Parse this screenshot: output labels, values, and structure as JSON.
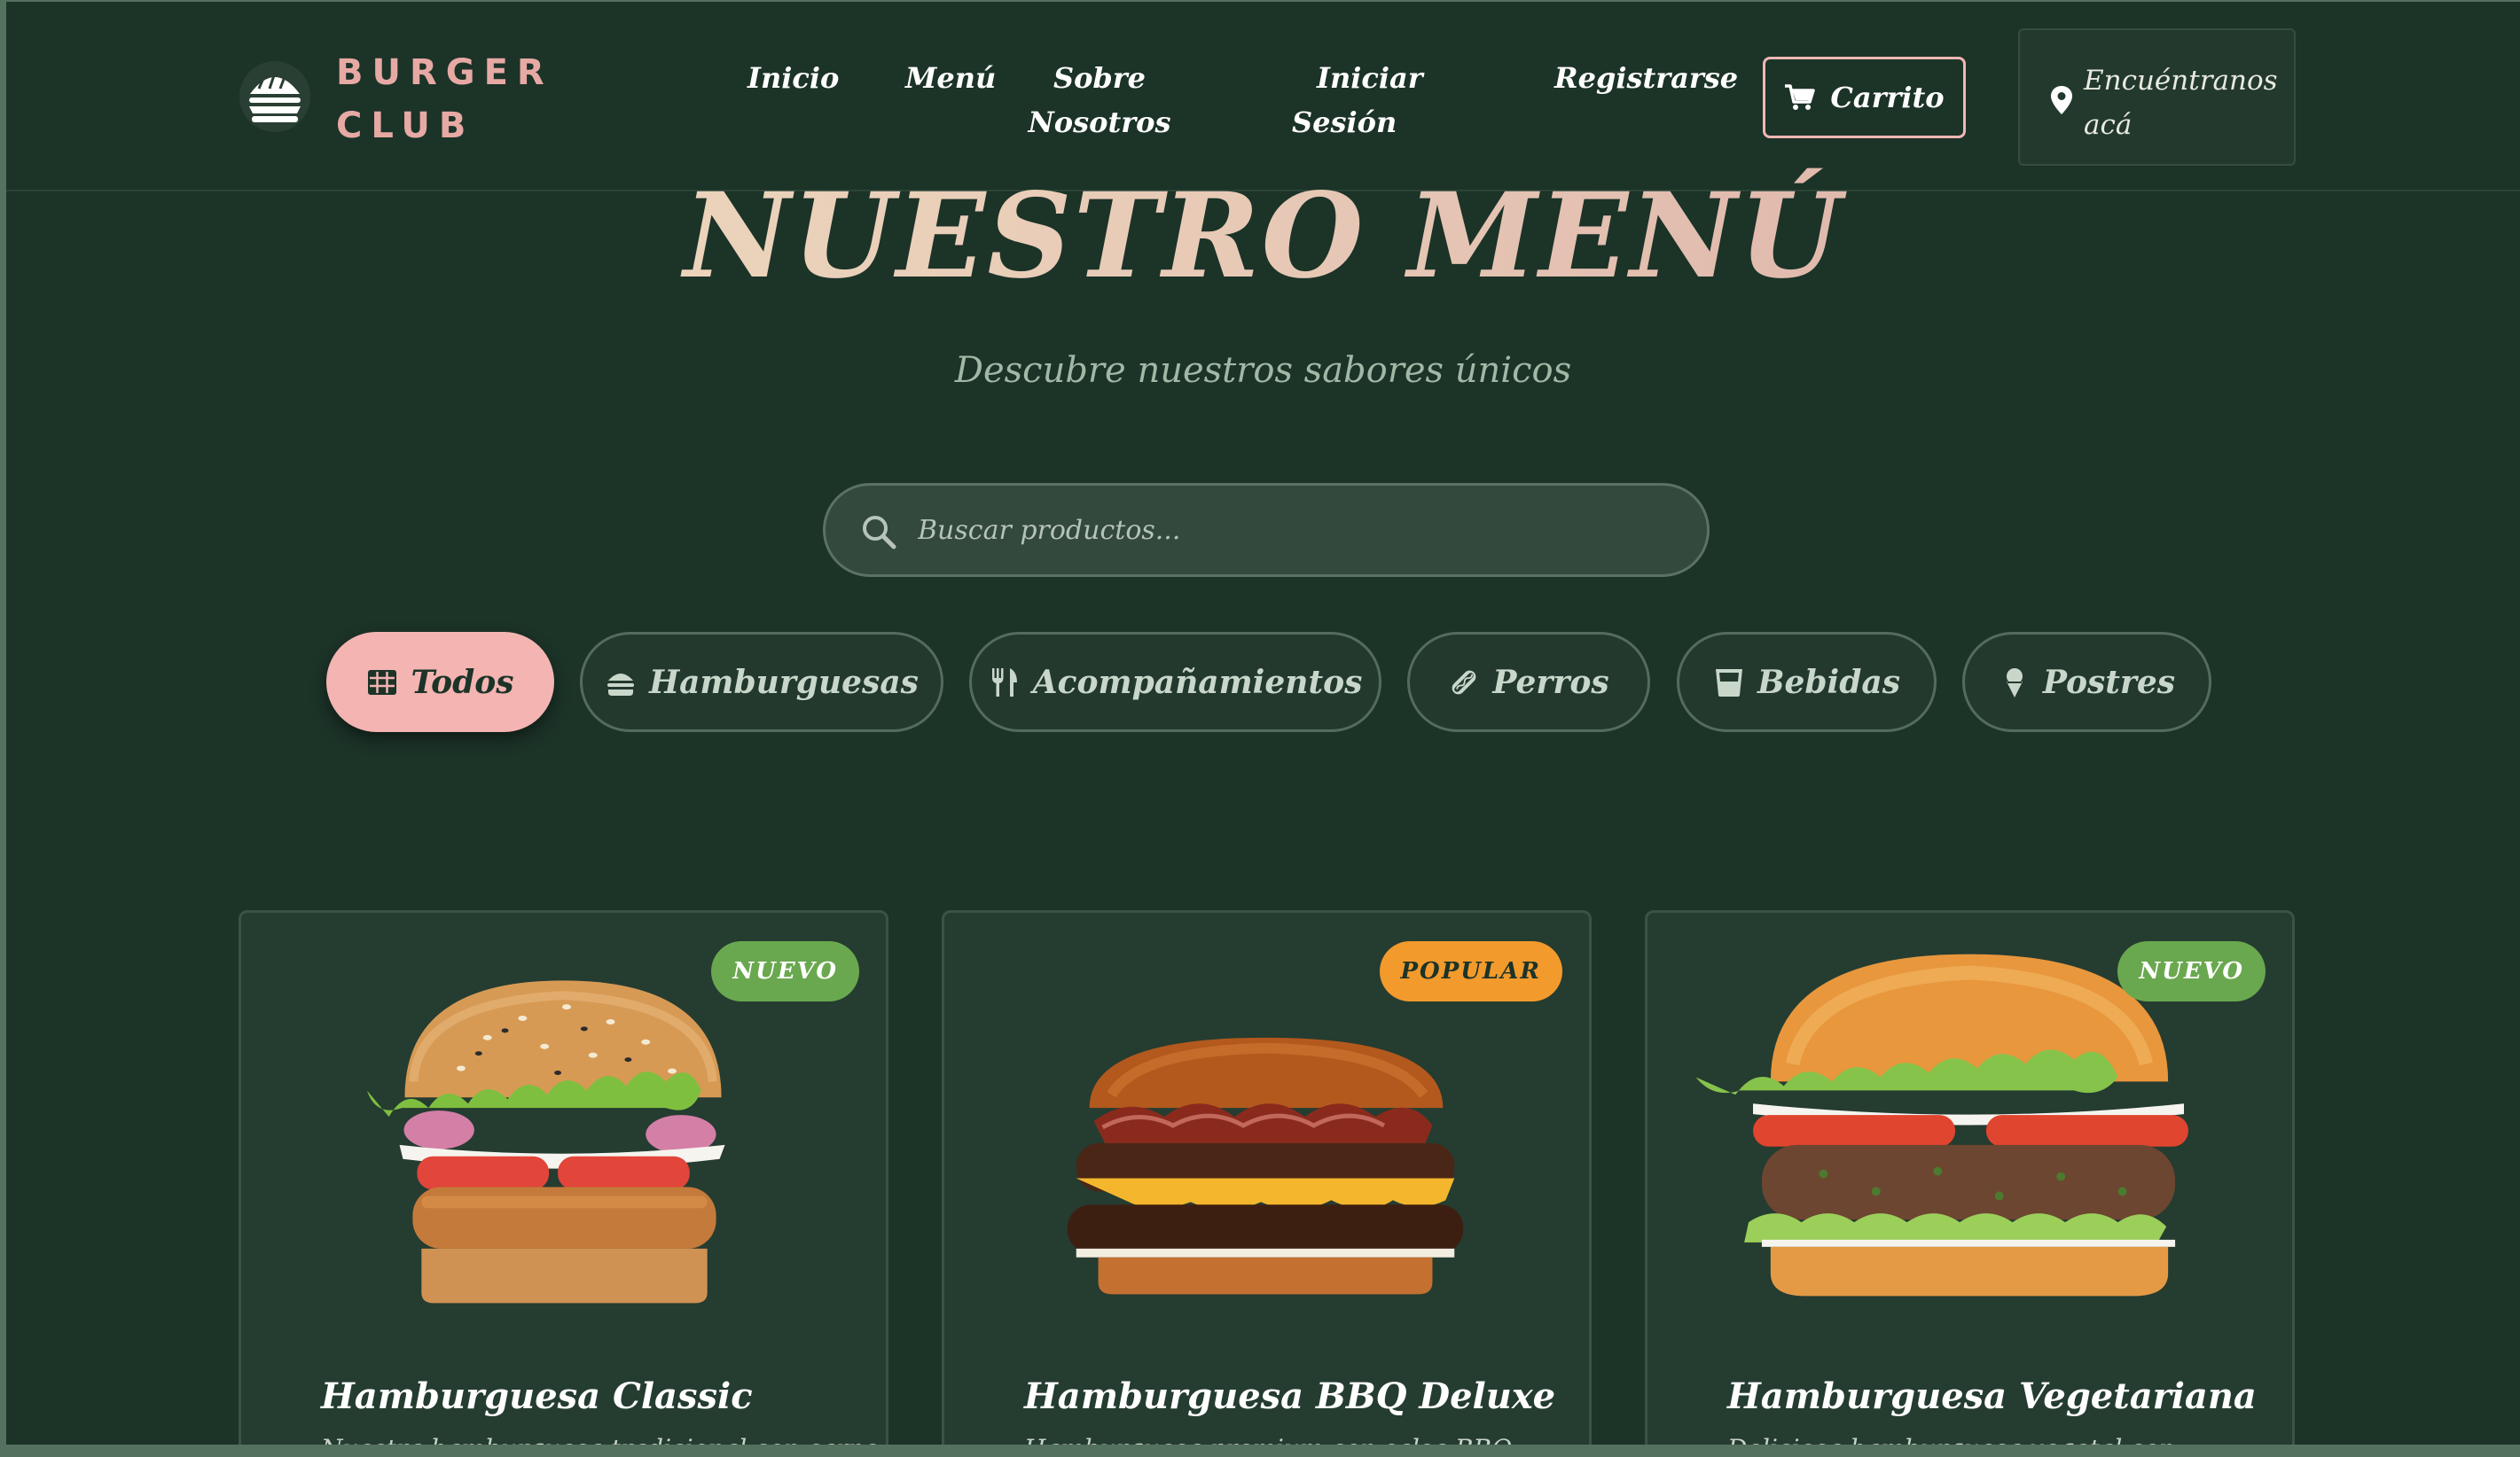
{
  "brand": {
    "line1": "BURGER",
    "line2": "CLUB"
  },
  "nav": {
    "inicio": "Inicio",
    "menu": "Menú",
    "sobre_1": "Sobre",
    "sobre_2": "Nosotros",
    "iniciar_1": "Iniciar",
    "iniciar_2": "Sesión",
    "registrarse": "Registrarse",
    "carrito": "Carrito",
    "encuentranos_1": "Encuéntranos",
    "encuentranos_2": "acá"
  },
  "hero": {
    "title": "NUESTRO MENÚ",
    "subtitle": "Descubre nuestros sabores únicos"
  },
  "search": {
    "placeholder": "Buscar productos..."
  },
  "categories": [
    {
      "label": "Todos",
      "icon": "grid-icon",
      "active": true
    },
    {
      "label": "Hamburguesas",
      "icon": "burger-icon",
      "active": false
    },
    {
      "label": "Acompañamientos",
      "icon": "utensils-icon",
      "active": false
    },
    {
      "label": "Perros",
      "icon": "hotdog-icon",
      "active": false
    },
    {
      "label": "Bebidas",
      "icon": "glass-icon",
      "active": false
    },
    {
      "label": "Postres",
      "icon": "icecream-icon",
      "active": false
    }
  ],
  "products": [
    {
      "badge": "NUEVO",
      "badge_color": "#6aa84f",
      "title": "Hamburguesa Classic",
      "desc": "Nuestra hamburguesa tradicional con carne"
    },
    {
      "badge": "POPULAR",
      "badge_color": "#f39a2c",
      "title": "Hamburguesa BBQ Deluxe",
      "desc": "Hamburguesa premium con salsa BBQ"
    },
    {
      "badge": "NUEVO",
      "badge_color": "#6aa84f",
      "title": "Hamburguesa Vegetariana",
      "desc": "Deliciosa hamburguesa vegetal con"
    }
  ],
  "colors": {
    "background": "#1c3328",
    "accent_pink": "#f3b4b2",
    "brand_pink": "#e7a9a4",
    "badge_green": "#6aa84f",
    "badge_orange": "#f39a2c"
  }
}
